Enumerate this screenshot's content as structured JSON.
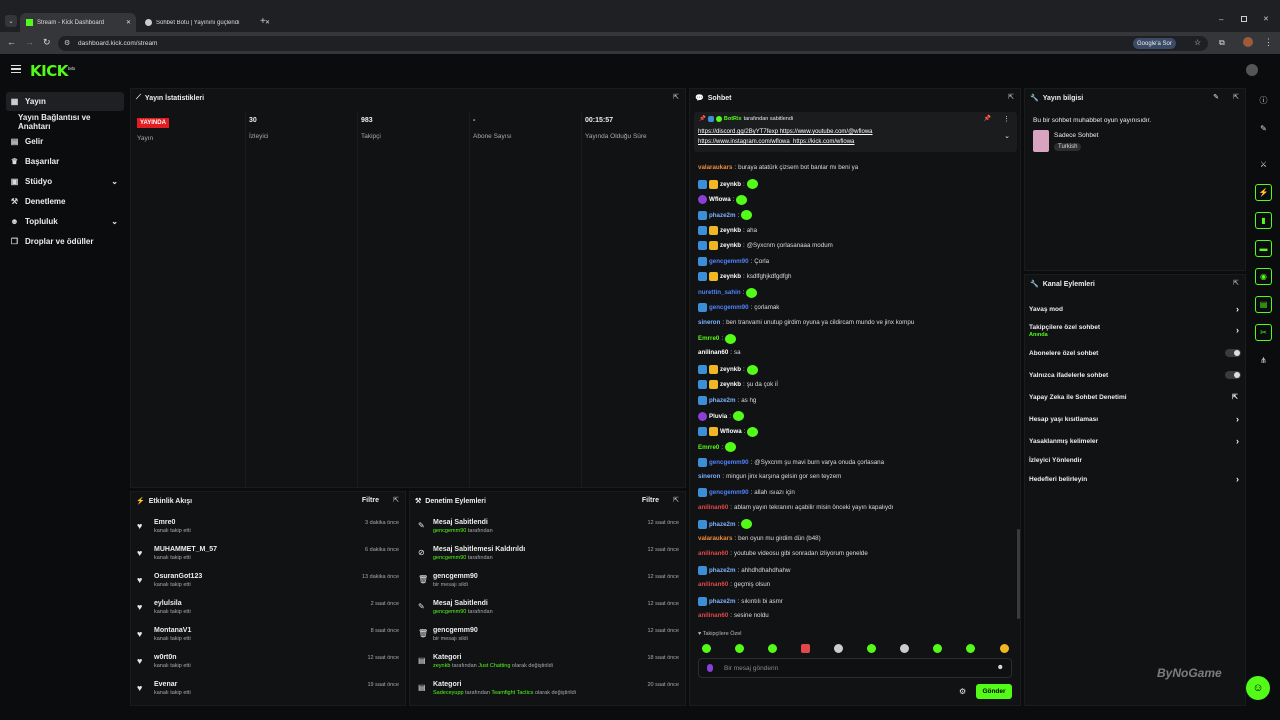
{
  "browser": {
    "tabs": [
      {
        "label": "Stream - Kick Dashboard"
      },
      {
        "label": "Sohbet Botu | Yayınını güçlendi"
      }
    ],
    "url": "dashboard.kick.com/stream",
    "google_ask": "Google'a Sor"
  },
  "app": {
    "logo": "KICK",
    "logo_sup": "beta"
  },
  "sidebar": {
    "items": [
      {
        "label": "Yayın",
        "icon": "stream-icon"
      },
      {
        "label": "Yayın Bağlantısı ve Anahtarı",
        "icon": ""
      },
      {
        "label": "Gelir",
        "icon": "money-icon"
      },
      {
        "label": "Başarılar",
        "icon": "trophy-icon"
      },
      {
        "label": "Stüdyo",
        "icon": "studio-icon"
      },
      {
        "label": "Denetleme",
        "icon": "hammer-icon"
      },
      {
        "label": "Topluluk",
        "icon": "community-icon"
      },
      {
        "label": "Droplar ve ödüller",
        "icon": "gift-icon"
      }
    ]
  },
  "stats": {
    "title": "Yayın İstatistikleri",
    "items": [
      {
        "value": "YAYINDA",
        "label": "Yayın"
      },
      {
        "value": "30",
        "label": "İzleyici"
      },
      {
        "value": "983",
        "label": "Takipçi"
      },
      {
        "value": "-",
        "label": "Abone Sayısı"
      },
      {
        "value": "00:15:57",
        "label": "Yayında Olduğu Süre"
      }
    ]
  },
  "events": {
    "title": "Etkinlik Akışı",
    "filter": "Filtre",
    "items": [
      {
        "name": "Emre0",
        "sub": "kanalı takip etti",
        "time": "3 dakika önce"
      },
      {
        "name": "MUHAMMET_M_57",
        "sub": "kanalı takip etti",
        "time": "6 dakika önce"
      },
      {
        "name": "OsuranGot123",
        "sub": "kanalı takip etti",
        "time": "13 dakika önce"
      },
      {
        "name": "eylulsila",
        "sub": "kanalı takip etti",
        "time": "2 saat önce"
      },
      {
        "name": "MontanaV1",
        "sub": "kanalı takip etti",
        "time": "8 saat önce"
      },
      {
        "name": "w0rt0n",
        "sub": "kanalı takip etti",
        "time": "12 saat önce"
      },
      {
        "name": "Evenar",
        "sub": "kanalı takip etti",
        "time": "19 saat önce"
      }
    ]
  },
  "moderation": {
    "title": "Denetim Eylemleri",
    "filter": "Filtre",
    "items": [
      {
        "name": "Mesaj Sabitlendi",
        "user": "gencgemm90",
        "sub": "tarafından",
        "extra": "",
        "extra2": "",
        "time": "12 saat önce",
        "icon": "pin-icon"
      },
      {
        "name": "Mesaj Sabitlemesi Kaldırıldı",
        "user": "gencgemm90",
        "sub": "tarafından",
        "extra": "",
        "extra2": "",
        "time": "12 saat önce",
        "icon": "unpin-icon"
      },
      {
        "name": "gencgemm90",
        "user": "",
        "sub": "bir mesajı sildi",
        "extra": "",
        "extra2": "",
        "time": "12 saat önce",
        "icon": "trash-icon"
      },
      {
        "name": "Mesaj Sabitlendi",
        "user": "gencgemm90",
        "sub": "tarafından",
        "extra": "",
        "extra2": "",
        "time": "12 saat önce",
        "icon": "pin-icon"
      },
      {
        "name": "gencgemm90",
        "user": "",
        "sub": "bir mesajı sildi",
        "extra": "",
        "extra2": "",
        "time": "12 saat önce",
        "icon": "trash-icon"
      },
      {
        "name": "Kategori",
        "user": "zeynkb",
        "sub": "tarafından",
        "extra": "Just Chatting",
        "extra2": "olarak değiştirildi",
        "time": "18 saat önce",
        "icon": "category-icon"
      },
      {
        "name": "Kategori",
        "user": "Sadeceyupp",
        "sub": "tarafından",
        "extra": "Teamfight Tactics",
        "extra2": "olarak değiştirildi",
        "time": "20 saat önce",
        "icon": "category-icon"
      }
    ]
  },
  "chat": {
    "title": "Sohbet",
    "pinned_by": "BotRix",
    "pinned_by_suffix": "tarafından sabitlendi",
    "pinned_links": [
      "https://discord.gg/2ByYT7fexp",
      "https://www.youtube.com/@wflowa",
      "https://www.instagram.com/wflowa",
      "https://kick.com/wflowa"
    ],
    "messages": [
      {
        "user": "valaraukars",
        "color": "#f08c3a",
        "text": "buraya atatürk çizsem bot banlar mı beni ya",
        "badge": "",
        "emote": false
      },
      {
        "user": "zeynkb",
        "color": "#ffffff",
        "text": "",
        "badge": "bg",
        "emote": true
      },
      {
        "user": "Wflowa",
        "color": "#ffffff",
        "text": "",
        "badge": "p",
        "emote": true
      },
      {
        "user": "phaze2m",
        "color": "#7cb4ff",
        "text": "",
        "badge": "b",
        "emote": true
      },
      {
        "user": "zeynkb",
        "color": "#ffffff",
        "text": "aha",
        "badge": "bg",
        "emote": false
      },
      {
        "user": "zeynkb",
        "color": "#ffffff",
        "text": "@Syxcnm çorlasanaaa modum",
        "badge": "bg",
        "emote": false
      },
      {
        "user": "gencgemm90",
        "color": "#4f83ff",
        "text": "Çorla",
        "badge": "b",
        "emote": false
      },
      {
        "user": "zeynkb",
        "color": "#ffffff",
        "text": "ksdlfghjkdfgdfgh",
        "badge": "bg",
        "emote": false
      },
      {
        "user": "nurettin_sahin",
        "color": "#4f83ff",
        "text": "",
        "badge": "",
        "emote": true
      },
      {
        "user": "gencgemm90",
        "color": "#4f83ff",
        "text": "çorlamak",
        "badge": "b",
        "emote": false
      },
      {
        "user": "sineron",
        "color": "#7cb4ff",
        "text": "ben tranvami unutup girdim oyuna ya cildircam mundo ve jinx kompu",
        "badge": "",
        "emote": false
      },
      {
        "user": "Emrre0",
        "color": "#53fc18",
        "text": "",
        "badge": "",
        "emote": true
      },
      {
        "user": "anilinan60",
        "color": "#ffffff",
        "text": "sa",
        "badge": "",
        "emote": false
      },
      {
        "user": "zeynkb",
        "color": "#ffffff",
        "text": "",
        "badge": "bg",
        "emote": true
      },
      {
        "user": "zeynkb",
        "color": "#ffffff",
        "text": "şu da çok iİ",
        "badge": "bg",
        "emote": false
      },
      {
        "user": "phaze2m",
        "color": "#7cb4ff",
        "text": "as hg",
        "badge": "b",
        "emote": false
      },
      {
        "user": "Pluvia",
        "color": "#ffffff",
        "text": "",
        "badge": "p",
        "emote": true
      },
      {
        "user": "Wflowa",
        "color": "#ffffff",
        "text": "",
        "badge": "bg",
        "emote": true
      },
      {
        "user": "Emrre0",
        "color": "#53fc18",
        "text": "",
        "badge": "",
        "emote": true
      },
      {
        "user": "gencgemm90",
        "color": "#4f83ff",
        "text": "@Syxcnm şu mavi burn varya onuda çorlasana",
        "badge": "b",
        "emote": false
      },
      {
        "user": "sineron",
        "color": "#7cb4ff",
        "text": "mingun jinx karşına gelsin gor sen teyzem",
        "badge": "",
        "emote": false
      },
      {
        "user": "gencgemm90",
        "color": "#4f83ff",
        "text": "allah ısıazı için",
        "badge": "b",
        "emote": false
      },
      {
        "user": "anilinan60",
        "color": "#e0484b",
        "text": "ablam yayın tekranını açabilir misin önceki yayın kapalıydı",
        "badge": "",
        "emote": false
      },
      {
        "user": "phaze2m",
        "color": "#7cb4ff",
        "text": "",
        "badge": "b",
        "emote": true
      },
      {
        "user": "valaraukars",
        "color": "#f08c3a",
        "text": "ben oyun mu girdim dün (b48)",
        "badge": "",
        "emote": false
      },
      {
        "user": "anilinan60",
        "color": "#e0484b",
        "text": "youtube videosu gibi sonradan izliyorum genelde",
        "badge": "",
        "emote": false
      },
      {
        "user": "phaze2m",
        "color": "#7cb4ff",
        "text": "ahhdhdhahdhahw",
        "badge": "b",
        "emote": false
      },
      {
        "user": "anilinan60",
        "color": "#e0484b",
        "text": "geçmiş olsun",
        "badge": "",
        "emote": false
      },
      {
        "user": "phaze2m",
        "color": "#7cb4ff",
        "text": "sıkıntılı bi asmr",
        "badge": "b",
        "emote": false
      },
      {
        "user": "anilinan60",
        "color": "#e0484b",
        "text": "sesine noldu",
        "badge": "",
        "emote": false
      }
    ],
    "followers_only": "Takipçilere Özel",
    "input_placeholder": "Bir mesaj gönderin",
    "send": "Gönder"
  },
  "stream_info": {
    "title": "Yayın bilgisi",
    "description": "Bu bir sohbet muhabbet oyun yayınısıdır.",
    "category": "Sadece Sohbet",
    "language": "Turkish"
  },
  "channel_actions": {
    "title": "Kanal Eylemleri",
    "items": [
      {
        "label": "Yavaş mod",
        "sub": "",
        "control": "arrow"
      },
      {
        "label": "Takipçilere özel sohbet",
        "sub": "Anında",
        "control": "arrow"
      },
      {
        "label": "Abonelere özel sohbet",
        "sub": "",
        "control": "toggle"
      },
      {
        "label": "Yalnızca ifadelerle sohbet",
        "sub": "",
        "control": "toggle"
      },
      {
        "label": "Yapay Zeka ile Sohbet Denetimi",
        "sub": "",
        "control": "external"
      },
      {
        "label": "Hesap yaşı kısıtlaması",
        "sub": "",
        "control": "arrow"
      },
      {
        "label": "Yasaklanmış kelimeler",
        "sub": "",
        "control": "arrow"
      },
      {
        "label": "İzleyici Yönlendir",
        "sub": "",
        "control": ""
      },
      {
        "label": "Hedefleri belirleyin",
        "sub": "",
        "control": "arrow"
      }
    ]
  },
  "watermark": "ByNoGame",
  "colors": {
    "accent": "#53fc18",
    "live": "#e11d22",
    "panel": "#111214"
  }
}
